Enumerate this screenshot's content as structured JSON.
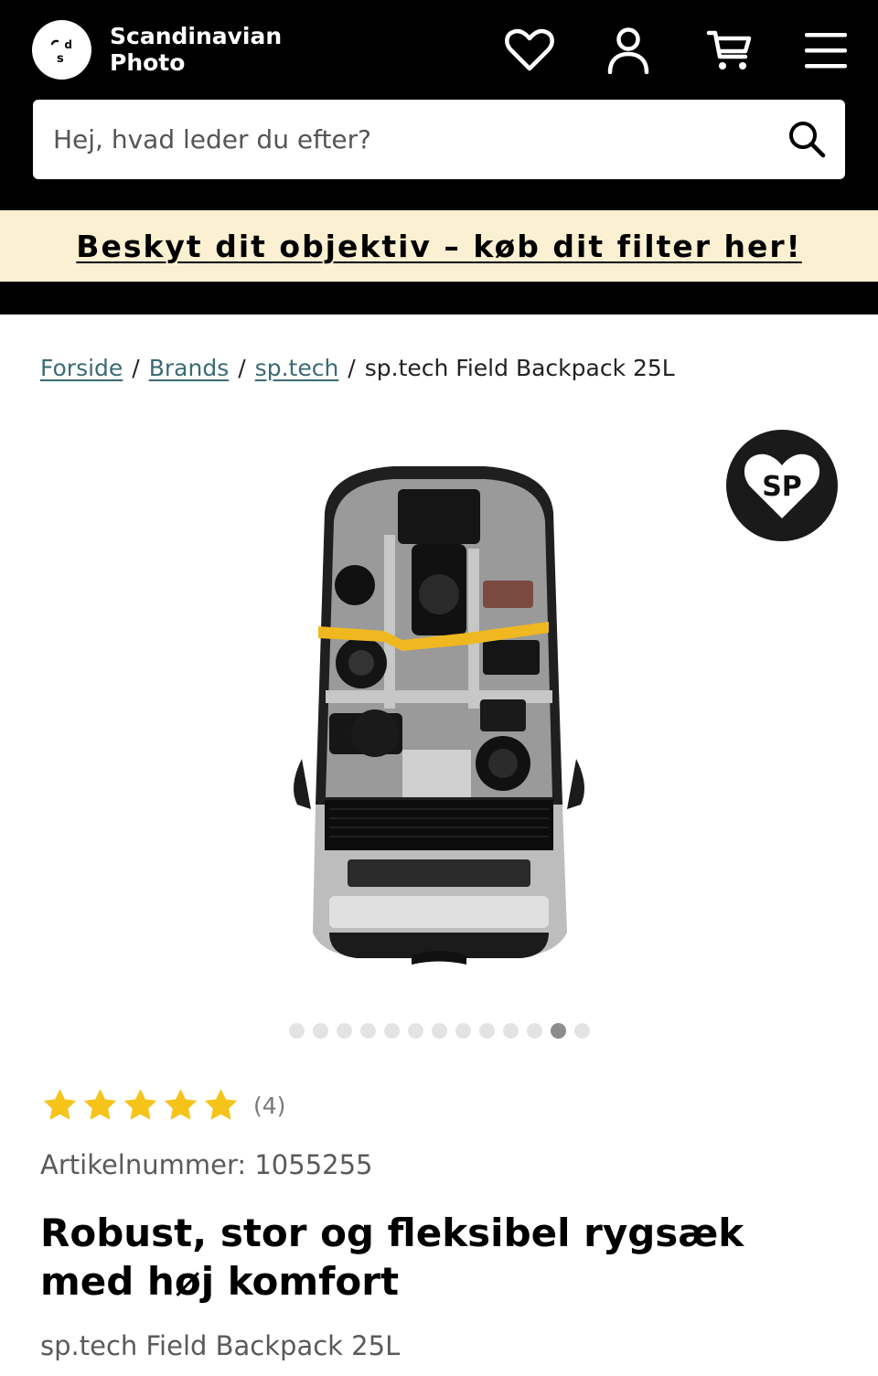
{
  "header": {
    "brand_line1": "Scandinavian",
    "brand_line2": "Photo",
    "background": "#000000"
  },
  "search": {
    "placeholder": "Hej, hvad leder du efter?",
    "value": ""
  },
  "promo": {
    "text": "Beskyt dit objektiv – køb dit filter her!",
    "background": "#fbf0d2"
  },
  "breadcrumb": {
    "items": [
      "Forside",
      "Brands",
      "sp.tech"
    ],
    "current": "sp.tech Field Backpack 25L",
    "link_color": "#3a6b74"
  },
  "gallery": {
    "badge_text": "SP",
    "dot_count": 13,
    "active_index": 11
  },
  "product": {
    "rating": 5,
    "review_count": "(4)",
    "sku": "Artikelnummer: 1055255",
    "title": "Robust, stor og fleksibel rygsæk med høj komfort",
    "subtitle": "sp.tech Field Backpack 25L",
    "star_color": "#f5c31a"
  },
  "icons": {
    "wishlist": "heart-icon",
    "account": "user-icon",
    "cart": "cart-icon",
    "menu": "hamburger-icon",
    "search": "search-icon"
  }
}
